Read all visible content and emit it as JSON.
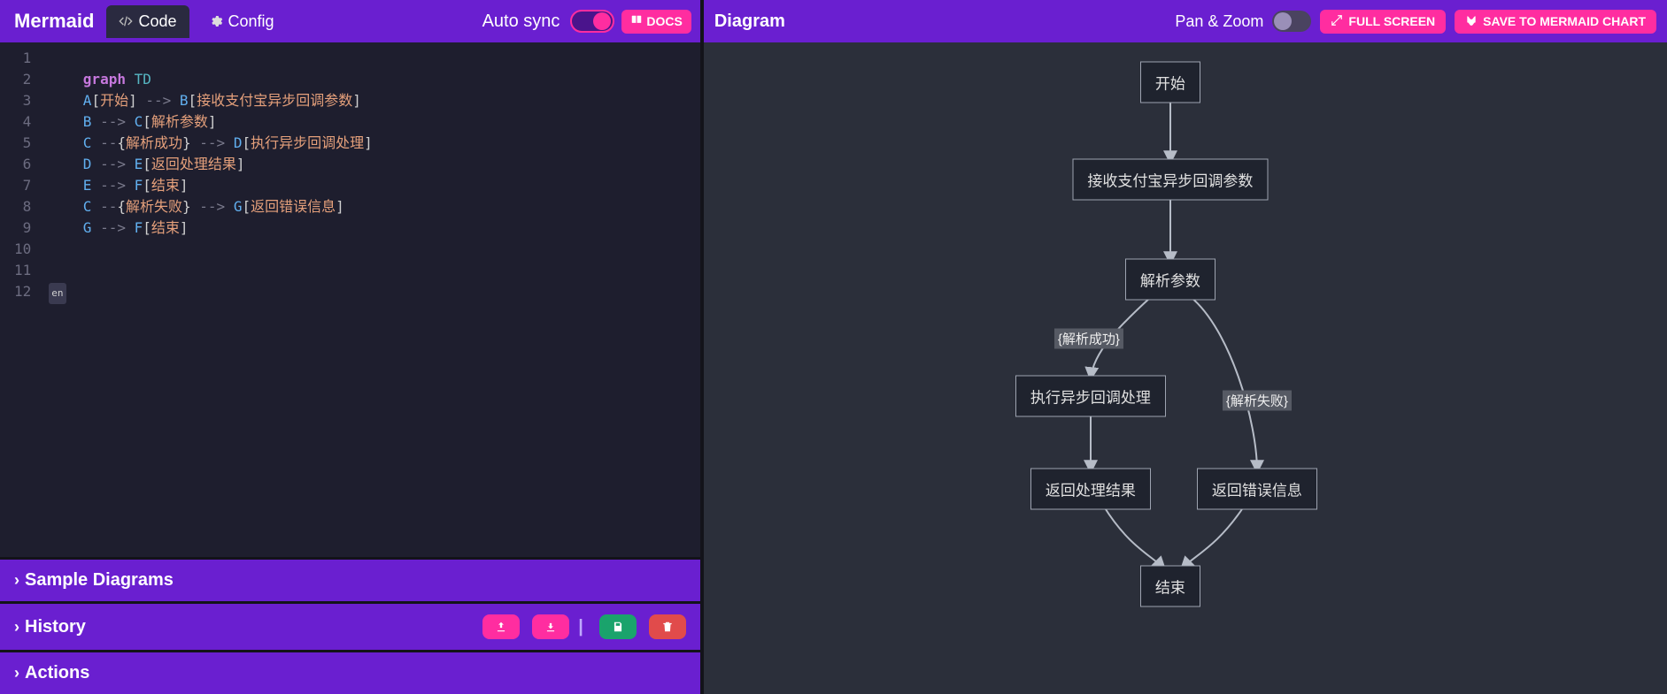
{
  "brand": "Mermaid",
  "tabs": {
    "code": "Code",
    "config": "Config"
  },
  "autosync": "Auto sync",
  "docs": "DOCS",
  "editor": {
    "lines": [
      "",
      "graph TD",
      "A[开始] --> B[接收支付宝异步回调参数]",
      "B --> C[解析参数]",
      "C --{解析成功} --> D[执行异步回调处理]",
      "D --> E[返回处理结果]",
      "E --> F[结束]",
      "C --{解析失败} --> G[返回错误信息]",
      "G --> F[结束]",
      "",
      "",
      ""
    ],
    "line_count": 12
  },
  "sections": {
    "sample": "Sample Diagrams",
    "history": "History",
    "actions": "Actions"
  },
  "right": {
    "title": "Diagram",
    "panzoom": "Pan & Zoom",
    "fullscreen": "FULL SCREEN",
    "save": "SAVE TO MERMAID CHART"
  },
  "diagram": {
    "nodes": {
      "A": "开始",
      "B": "接收支付宝异步回调参数",
      "C": "解析参数",
      "D": "执行异步回调处理",
      "E": "返回处理结果",
      "F": "结束",
      "G": "返回错误信息"
    },
    "edge_labels": {
      "CD": "{解析成功}",
      "CG": "{解析失败}"
    }
  }
}
